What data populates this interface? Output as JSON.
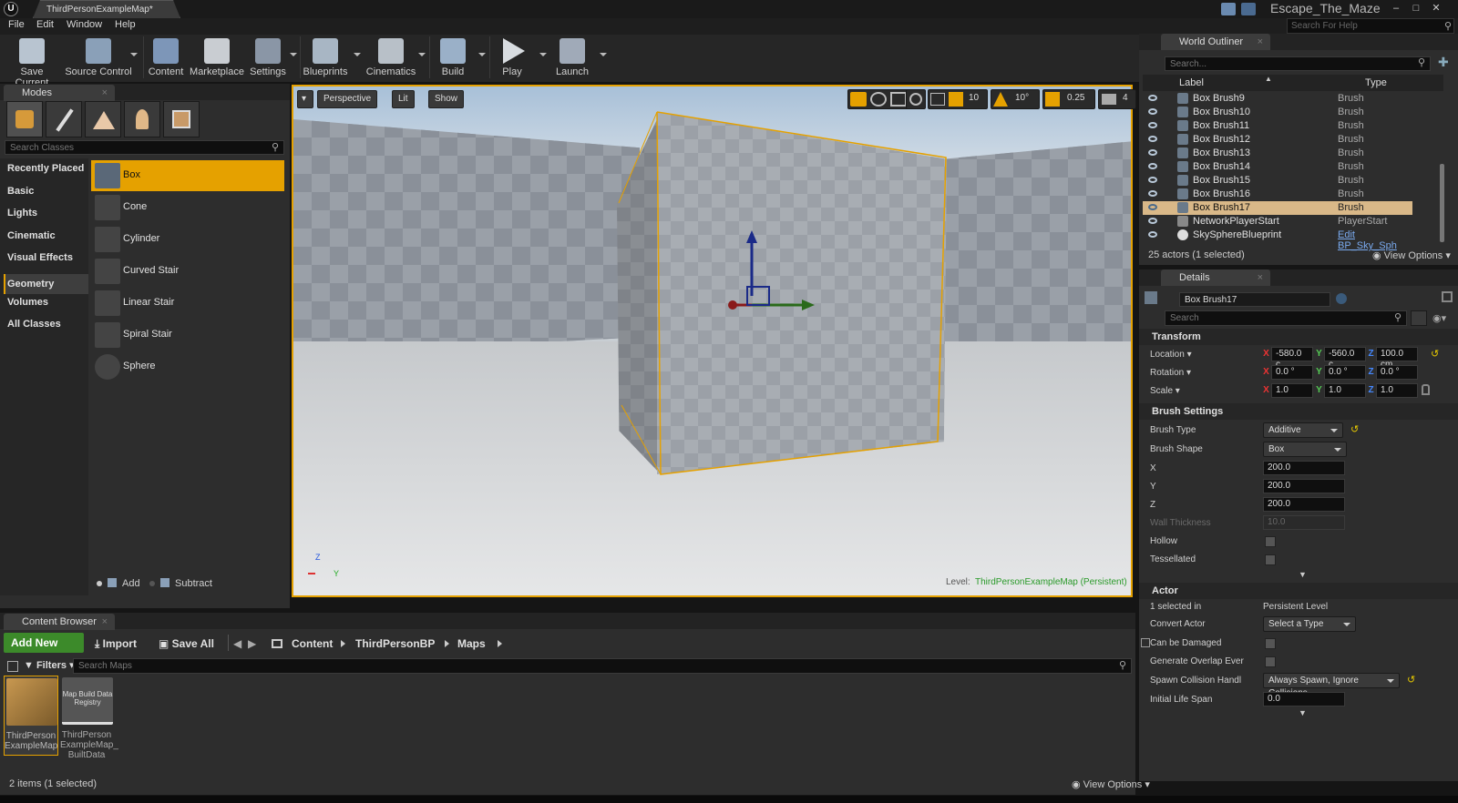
{
  "titlebar": {
    "logo": "U",
    "tab": "ThirdPersonExampleMap*",
    "project": "Escape_The_Maze",
    "min": "–",
    "max": "□",
    "close": "✕"
  },
  "menus": [
    "File",
    "Edit",
    "Window",
    "Help"
  ],
  "help_search": {
    "placeholder": "Search For Help"
  },
  "toolbar": {
    "save": "Save Current",
    "source": "Source Control",
    "content": "Content",
    "marketplace": "Marketplace",
    "settings": "Settings",
    "blueprints": "Blueprints",
    "cinematics": "Cinematics",
    "build": "Build",
    "play": "Play",
    "launch": "Launch"
  },
  "modes": {
    "tab": "Modes",
    "search_placeholder": "Search Classes",
    "categories": [
      "Recently Placed",
      "Basic",
      "Lights",
      "Cinematic",
      "Visual Effects",
      "Geometry",
      "Volumes",
      "All Classes"
    ],
    "selected_category": "Geometry",
    "shapes": [
      "Box",
      "Cone",
      "Cylinder",
      "Curved Stair",
      "Linear Stair",
      "Spiral Stair",
      "Sphere"
    ],
    "selected_shape": "Box",
    "add": "Add",
    "subtract": "Subtract"
  },
  "viewport": {
    "perspective": "Perspective",
    "lit": "Lit",
    "show": "Show",
    "grid": "10",
    "angle": "10°",
    "scale": "0.25",
    "cam_speed": "4",
    "level_label": "Level:",
    "level_name": "ThirdPersonExampleMap (Persistent)",
    "axis_z": "Z",
    "axis_y": "Y"
  },
  "outliner": {
    "tab": "World Outliner",
    "search_placeholder": "Search...",
    "col_label": "Label",
    "col_type": "Type",
    "rows": [
      {
        "name": "Box Brush9",
        "type": "Brush"
      },
      {
        "name": "Box Brush10",
        "type": "Brush"
      },
      {
        "name": "Box Brush11",
        "type": "Brush"
      },
      {
        "name": "Box Brush12",
        "type": "Brush"
      },
      {
        "name": "Box Brush13",
        "type": "Brush"
      },
      {
        "name": "Box Brush14",
        "type": "Brush"
      },
      {
        "name": "Box Brush15",
        "type": "Brush"
      },
      {
        "name": "Box Brush16",
        "type": "Brush"
      },
      {
        "name": "Box Brush17",
        "type": "Brush"
      },
      {
        "name": "NetworkPlayerStart",
        "type": "PlayerStart"
      },
      {
        "name": "SkySphereBlueprint",
        "type": "Edit BP_Sky_Sph"
      }
    ],
    "selected_row": 8,
    "status": "25 actors (1 selected)",
    "view_options": "View Options"
  },
  "details": {
    "tab": "Details",
    "name": "Box Brush17",
    "search_placeholder": "Search",
    "transform": {
      "header": "Transform",
      "location_label": "Location",
      "location": [
        "-580.0 c",
        "-560.0 c",
        "100.0 cm"
      ],
      "rotation_label": "Rotation",
      "rotation": [
        "0.0 °",
        "0.0 °",
        "0.0 °"
      ],
      "scale_label": "Scale",
      "scale": [
        "1.0",
        "1.0",
        "1.0"
      ]
    },
    "brush": {
      "header": "Brush Settings",
      "type_label": "Brush Type",
      "type": "Additive",
      "shape_label": "Brush Shape",
      "shape": "Box",
      "x_label": "X",
      "x": "200.0",
      "y_label": "Y",
      "y": "200.0",
      "z_label": "Z",
      "z": "200.0",
      "wall_label": "Wall Thickness",
      "wall": "10.0",
      "hollow_label": "Hollow",
      "tess_label": "Tessellated"
    },
    "actor": {
      "header": "Actor",
      "selected_label": "1 selected in",
      "selected_value": "Persistent Level",
      "convert_label": "Convert Actor",
      "convert": "Select a Type",
      "damage_label": "Can be Damaged",
      "overlap_label": "Generate Overlap Ever",
      "spawn_label": "Spawn Collision Handl",
      "spawn": "Always Spawn, Ignore Collisions",
      "life_label": "Initial Life Span",
      "life": "0.0"
    }
  },
  "content_browser": {
    "tab": "Content Browser",
    "add_new": "Add New",
    "import": "Import",
    "save_all": "Save All",
    "path": [
      "Content",
      "ThirdPersonBP",
      "Maps"
    ],
    "filters": "Filters",
    "search_placeholder": "Search Maps",
    "assets": [
      {
        "thumb": "",
        "label": "ThirdPerson ExampleMap"
      },
      {
        "thumb": "Map Build Data Registry",
        "label": "ThirdPerson ExampleMap_ BuiltData"
      }
    ],
    "status": "2 items (1 selected)",
    "view_options": "View Options"
  }
}
